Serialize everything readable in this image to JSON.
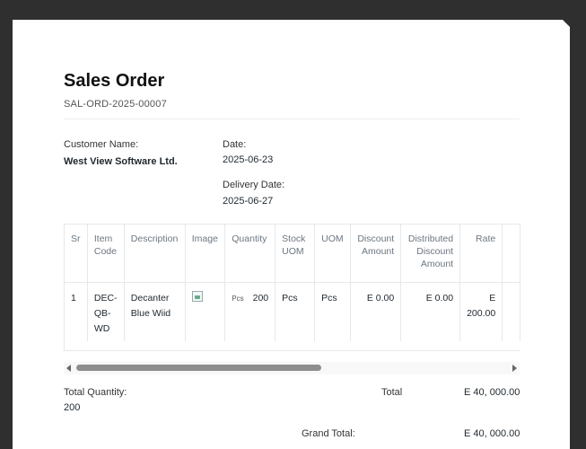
{
  "doc": {
    "title": "Sales Order",
    "id": "SAL-ORD-2025-00007"
  },
  "customer": {
    "label": "Customer Name:",
    "value": "West View Software Ltd."
  },
  "date": {
    "label": "Date:",
    "value": "2025-06-23"
  },
  "delivery": {
    "label": "Delivery Date:",
    "value": "2025-06-27"
  },
  "table": {
    "headers": {
      "sr": "Sr",
      "item_code": "Item Code",
      "description": "Description",
      "image": "Image",
      "quantity": "Quantity",
      "stock_uom": "Stock UOM",
      "uom": "UOM",
      "discount_amount": "Discount Amount",
      "distributed_discount_amount": "Distributed Discount Amount",
      "rate": "Rate"
    },
    "rows": [
      {
        "sr": "1",
        "item_code": "DEC-QB-WD",
        "description": "Decanter Blue Wiid",
        "qty_uom": "Pcs",
        "quantity": "200",
        "stock_uom": "Pcs",
        "uom": "Pcs",
        "discount_amount": "E 0.00",
        "distributed_discount_amount": "E 0.00",
        "rate": "E 200.00"
      }
    ]
  },
  "totals": {
    "total_quantity_label": "Total Quantity:",
    "total_quantity_value": "200",
    "total_label": "Total",
    "total_value": "E 40, 000.00",
    "grand_total_label": "Grand Total:",
    "grand_total_value": "E 40, 000.00"
  }
}
